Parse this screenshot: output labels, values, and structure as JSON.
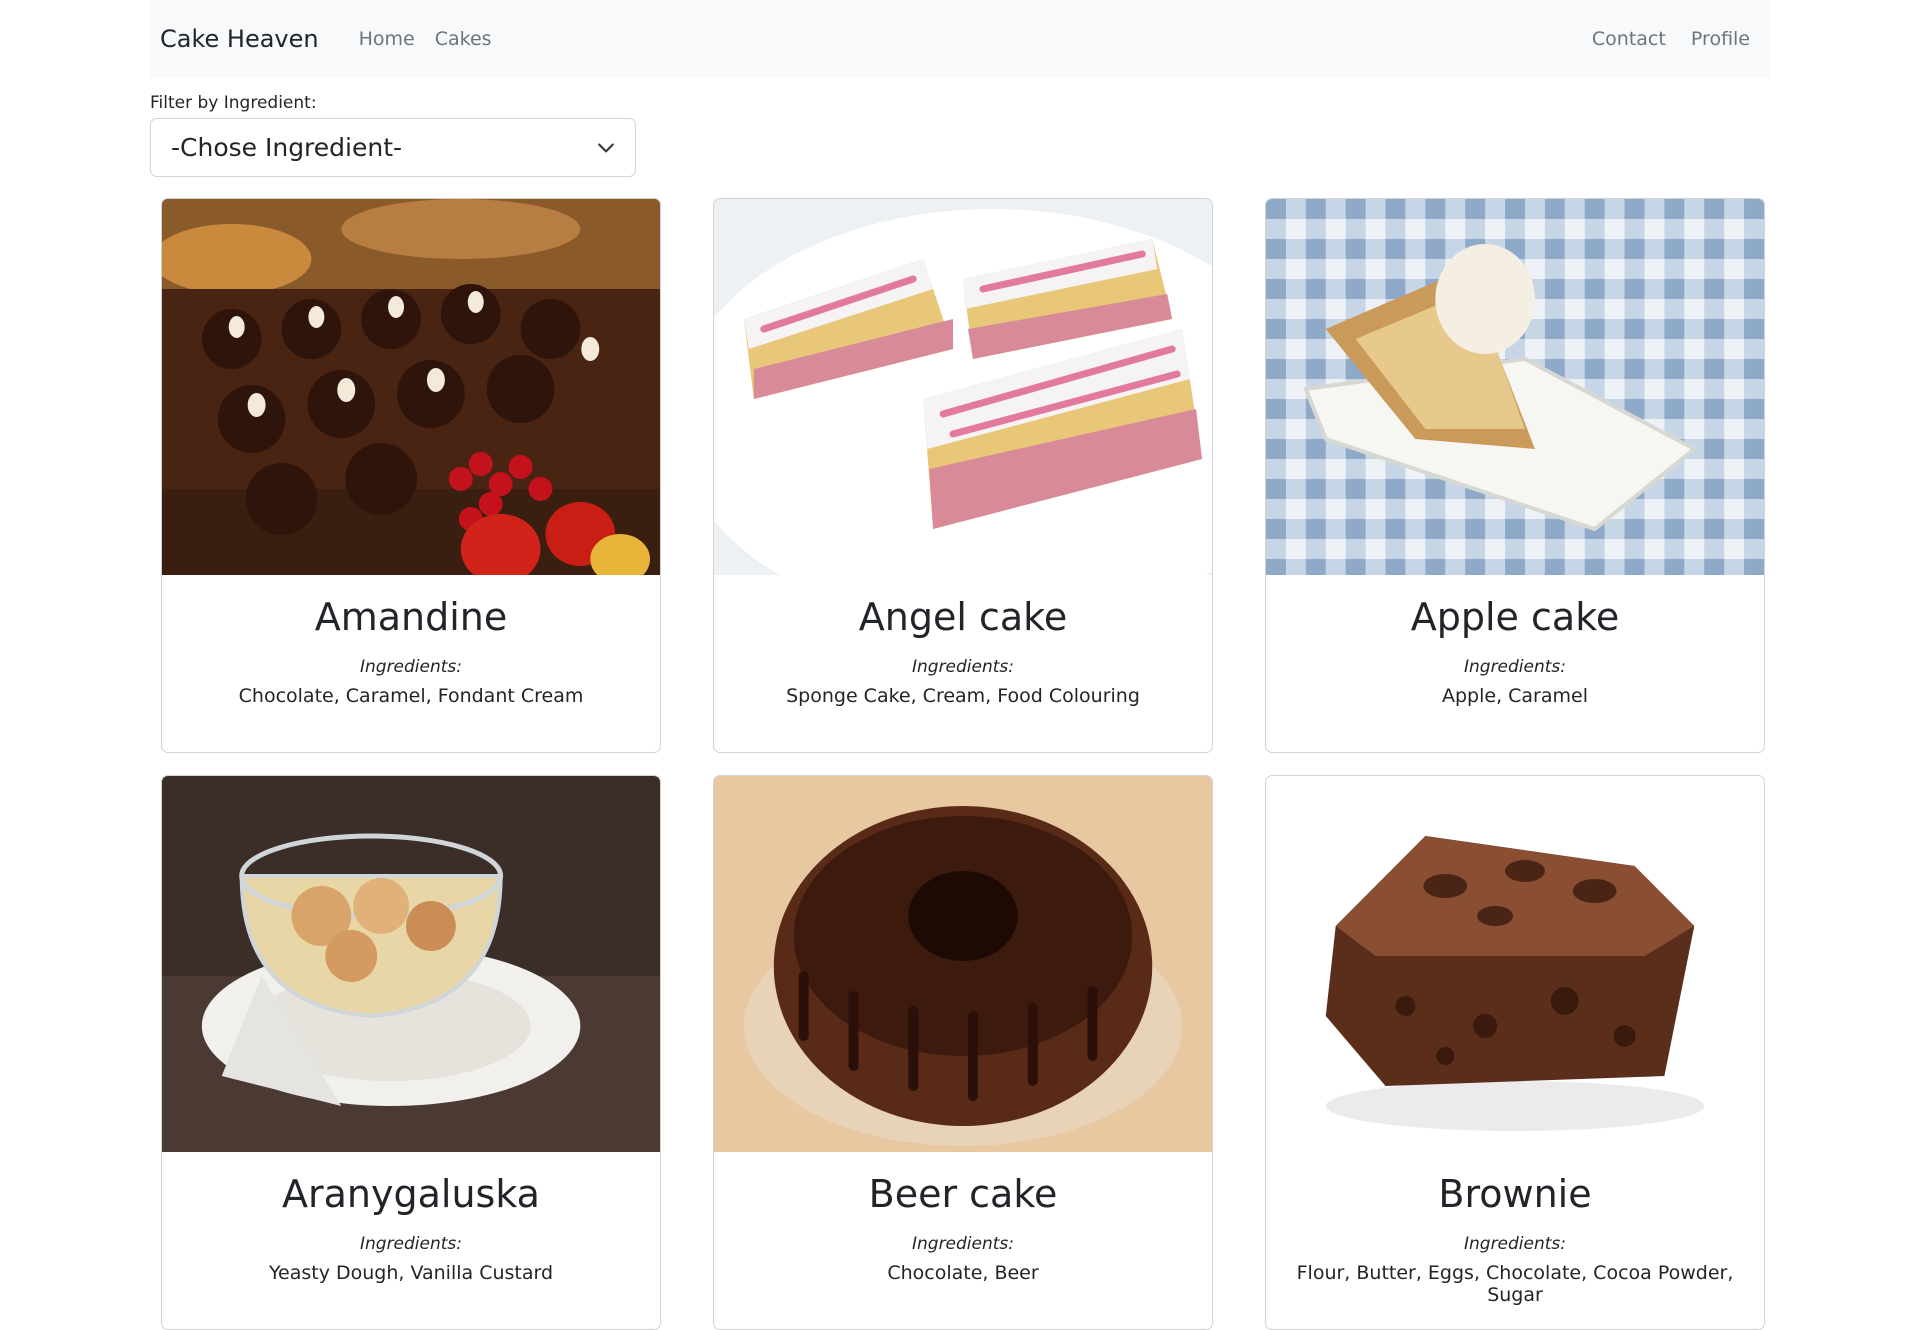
{
  "nav": {
    "brand": "Cake Heaven",
    "links_left": [
      "Home",
      "Cakes"
    ],
    "links_right": [
      "Contact",
      "Profile"
    ]
  },
  "filter": {
    "label": "Filter by Ingredient:",
    "selected": "-Chose Ingredient-"
  },
  "ingredients_label": "Ingredients:",
  "cakes": [
    {
      "name": "Amandine",
      "ingredients": "Chocolate, Caramel, Fondant Cream"
    },
    {
      "name": "Angel cake",
      "ingredients": "Sponge Cake, Cream, Food Colouring"
    },
    {
      "name": "Apple cake",
      "ingredients": "Apple, Caramel"
    },
    {
      "name": "Aranygaluska",
      "ingredients": "Yeasty Dough, Vanilla Custard"
    },
    {
      "name": "Beer cake",
      "ingredients": "Chocolate, Beer"
    },
    {
      "name": "Brownie",
      "ingredients": "Flour, Butter, Eggs, Chocolate, Cocoa Powder, Sugar"
    }
  ]
}
